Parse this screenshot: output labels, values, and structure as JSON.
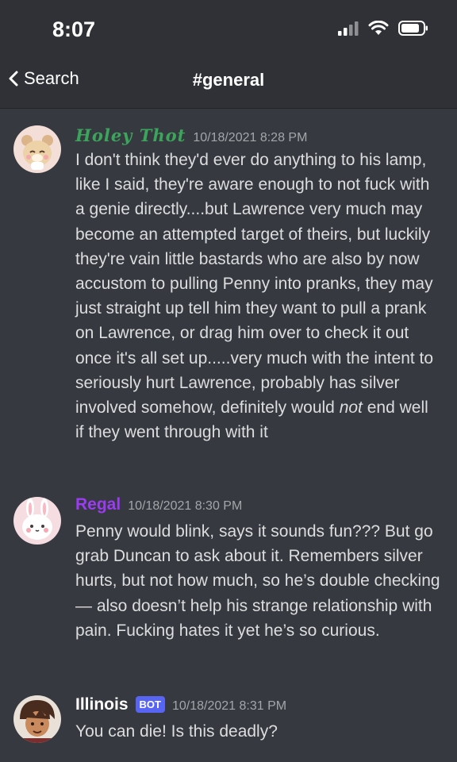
{
  "status_bar": {
    "time": "8:07"
  },
  "nav": {
    "back_label": "Search",
    "channel_title": "#general"
  },
  "messages": [
    {
      "author": "Holey Thot",
      "timestamp": "10/18/2021 8:28 PM",
      "text_main": "I don't think they'd ever do anything to his lamp, like I said, they're aware enough to not fuck with a genie directly....but Lawrence very much may become an attempted target of theirs, but luckily they're vain little bastards who are also by now accustom to pulling Penny into pranks, they may just straight up tell him they want to pull a prank on Lawrence, or drag him over to check it out once it's all set up.....very much with the intent to seriously hurt Lawrence, probably has silver involved somehow, definitely would",
      "text_emphasis": "not",
      "text_tail": " end well if they went through with it",
      "author_color": "#3ba55c"
    },
    {
      "author": "Regal",
      "timestamp": "10/18/2021 8:30 PM",
      "text": "Penny would blink, says it sounds fun??? But go grab Duncan to ask about it. Remembers silver hurts, but not how much, so he’s double checking— also doesn’t help his strange relationship with pain. Fucking hates it yet he’s so curious.",
      "author_color": "#9b3bf2"
    },
    {
      "author": "Illinois",
      "badge": "BOT",
      "timestamp": "10/18/2021 8:31 PM",
      "text": "You can die! Is this deadly?",
      "author_color": "#ffffff"
    }
  ],
  "colors": {
    "background": "#36393f",
    "header": "#2f3136",
    "bot_badge": "#5865f2"
  }
}
